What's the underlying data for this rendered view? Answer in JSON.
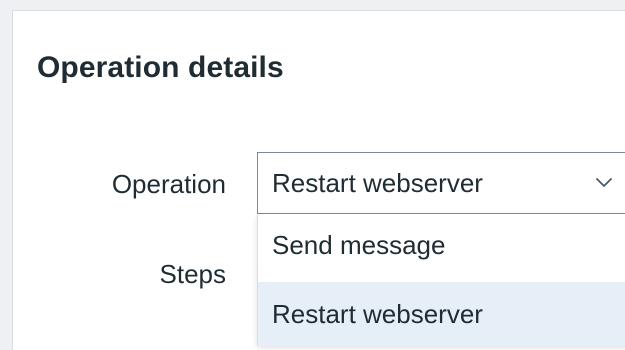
{
  "dialog": {
    "title": "Operation details"
  },
  "form": {
    "operation_label": "Operation",
    "steps_label": "Steps",
    "operation_select": {
      "selected_value": "Restart webserver",
      "icon": "chevron-down-icon",
      "options": [
        {
          "label": "Send message",
          "highlighted": false
        },
        {
          "label": "Restart webserver",
          "highlighted": true
        }
      ]
    }
  },
  "colors": {
    "text": "#1f2c33",
    "select_border": "#7a8b99",
    "option_highlight": "#e6eef7",
    "background": "#ffffff"
  }
}
